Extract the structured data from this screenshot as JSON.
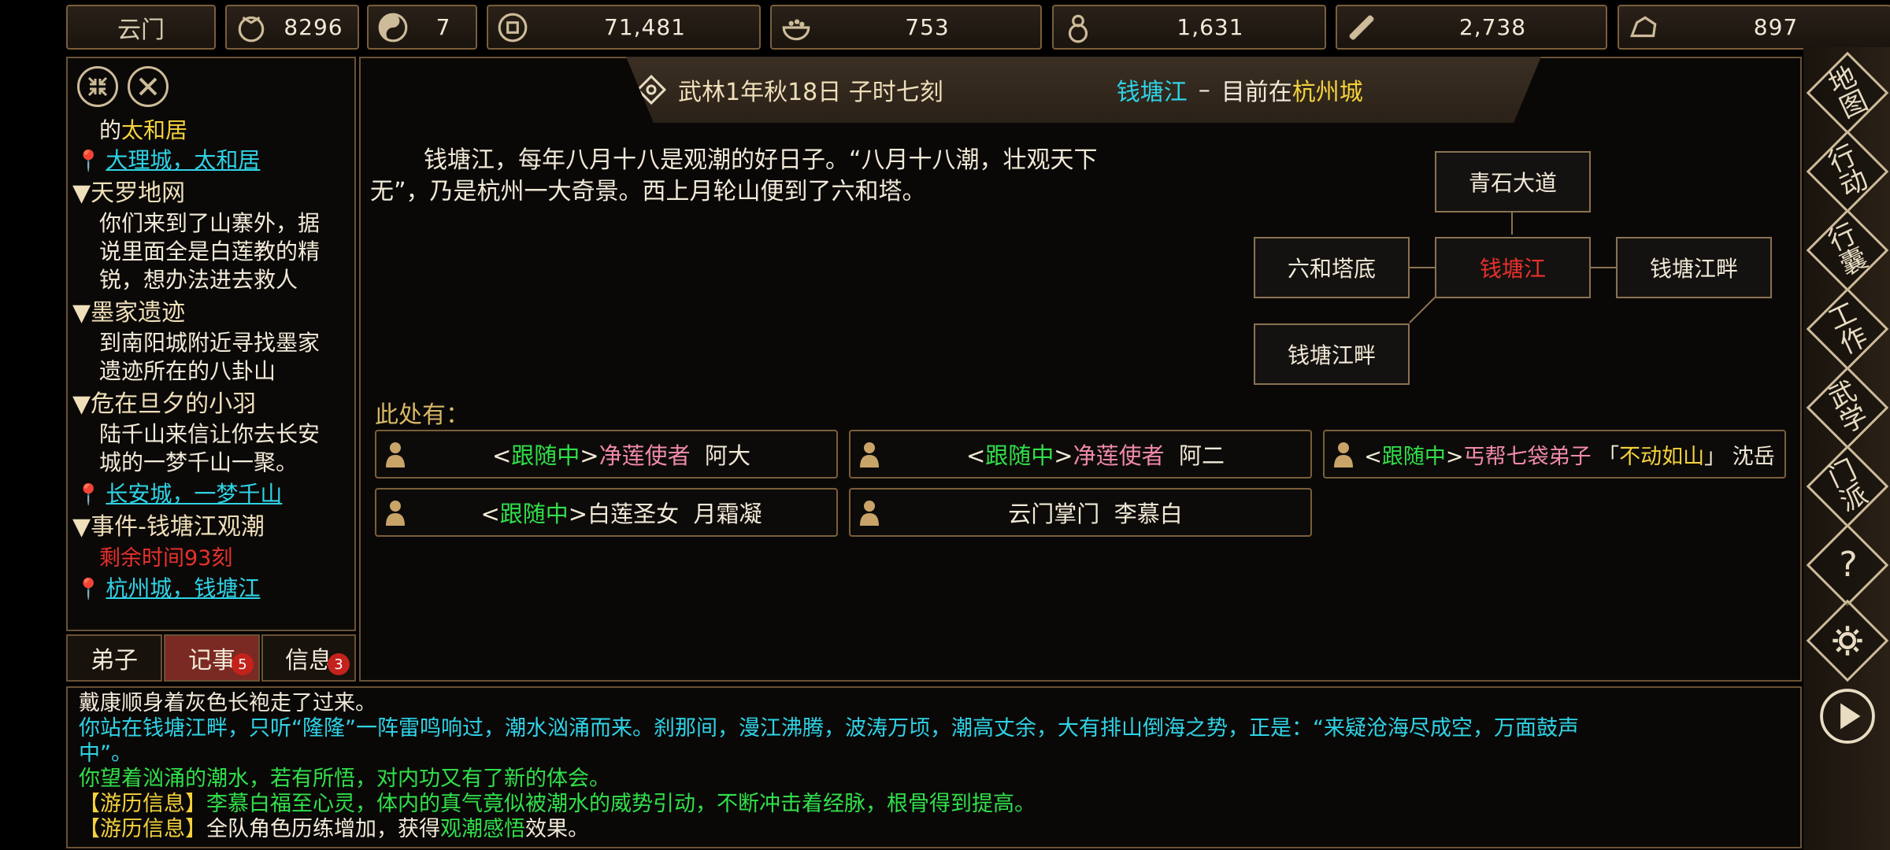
{
  "top_bar": {
    "sect_name": "云门",
    "resources": [
      {
        "icon": "reputation-icon",
        "value": "8296"
      },
      {
        "icon": "yin-yang-icon",
        "value": "7"
      },
      {
        "icon": "coin-icon",
        "value": "71,481"
      },
      {
        "icon": "food-bowl-icon",
        "value": "753"
      },
      {
        "icon": "gourd-icon",
        "value": "1,631"
      },
      {
        "icon": "scroll-icon",
        "value": "2,738"
      },
      {
        "icon": "ore-icon",
        "value": "897"
      }
    ]
  },
  "sidebar": {
    "line0_prefix": "的",
    "line0_place": "太和居",
    "link1": "大理城，太和居",
    "quests": [
      {
        "title": "天罗地网",
        "desc": [
          "你们来到了山寨外，据",
          "说里面全是白莲教的精",
          "锐，想办法进去救人"
        ]
      },
      {
        "title": "墨家遗迹",
        "desc": [
          "到南阳城附近寻找墨家",
          "遗迹所在的八卦山"
        ]
      },
      {
        "title": "危在旦夕的小羽",
        "desc": [
          "陆千山来信让你去长安",
          "城的一梦千山一聚。"
        ]
      }
    ],
    "link2": "长安城，一梦千山",
    "event_title": "事件-钱塘江观潮",
    "event_time": "剩余时间93刻",
    "link3": "杭州城，钱塘江",
    "arrow": "▼",
    "tabs": [
      {
        "label": "弟子",
        "badge": ""
      },
      {
        "label": "记事",
        "badge": "5"
      },
      {
        "label": "信息",
        "badge": "3"
      }
    ]
  },
  "header": {
    "date": "武林1年秋18日 子时七刻",
    "location": "钱塘江",
    "dash": "–",
    "current_prefix": "目前在",
    "current_city": "杭州城"
  },
  "description": {
    "line1": "钱塘江，每年八月十八是观潮的好日子。“八月十八潮，壮观天下",
    "line2": "无”，乃是杭州一大奇景。西上月轮山便到了六和塔。"
  },
  "map": {
    "north": "青石大道",
    "west": "六和塔底",
    "center": "钱塘江",
    "east": "钱塘江畔",
    "southwest": "钱塘江畔"
  },
  "present": {
    "label": "此处有：",
    "npcs": [
      {
        "follow": "跟随中",
        "title": "净莲使者",
        "name": "阿大"
      },
      {
        "follow": "跟随中",
        "title": "净莲使者",
        "name": "阿二"
      },
      {
        "follow": "跟随中",
        "title": "丐帮七袋弟子",
        "nick": "不动如山",
        "name": "沈岳"
      },
      {
        "follow": "跟随中",
        "title": "白莲圣女",
        "name": "月霜凝"
      },
      {
        "follow": "",
        "title": "云门掌门",
        "name": "李慕白"
      }
    ]
  },
  "right_menu": [
    {
      "label": "地图",
      "icon": ""
    },
    {
      "label": "行动",
      "icon": ""
    },
    {
      "label": "行囊",
      "icon": ""
    },
    {
      "label": "工作",
      "icon": ""
    },
    {
      "label": "武学",
      "icon": ""
    },
    {
      "label": "门派",
      "icon": ""
    },
    {
      "label": "?",
      "icon": "help-icon"
    },
    {
      "label": "",
      "icon": "settings-gear-icon"
    },
    {
      "label": "",
      "icon": "play-icon"
    }
  ],
  "log": {
    "l1": "戴康顺身着灰色长袍走了过来。",
    "l2": "你站在钱塘江畔，只听“隆隆”一阵雷鸣响过，潮水汹涌而来。刹那间，漫江沸腾，波涛万顷，潮高丈余，大有排山倒海之势，正是：“来疑沧海尽成空，万面鼓声",
    "l3": "中”。",
    "l4": "你望着汹涌的潮水，若有所悟，对内功又有了新的体会。",
    "tag": "【游历信息】",
    "l5": "李慕白福至心灵，体内的真气竟似被潮水的威势引动，不断冲击着经脉，根骨得到提高。",
    "l6a": "全队角色历练增加，获得",
    "l6b": "观潮感悟",
    "l6c": "效果。"
  },
  "colors": {
    "border": "#7a5e3a",
    "location": "#2fd3e6",
    "highlight": "#f4d23c",
    "follow": "#30e04a",
    "danger": "#e8312c"
  }
}
